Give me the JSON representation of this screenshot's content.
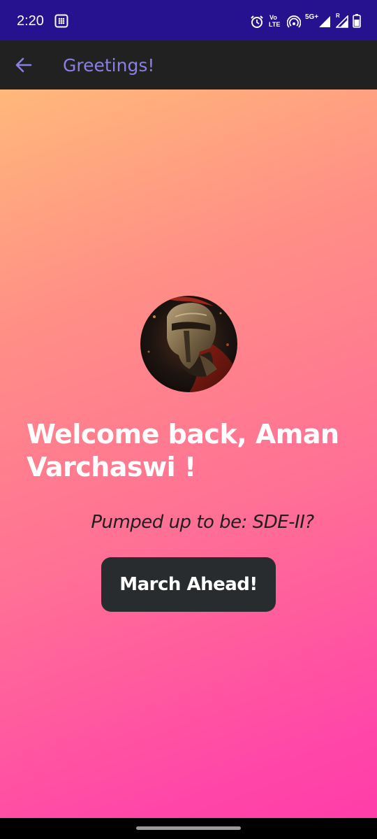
{
  "status_bar": {
    "time": "2:20",
    "volte_top": "Vo",
    "volte_bottom": "LTE",
    "network": "5G+",
    "roaming": "R",
    "background_color": "#26128f",
    "icons": [
      "notification-grid-icon",
      "alarm-icon",
      "volte-icon",
      "hotspot-icon",
      "signal-icon",
      "signal-roaming-icon",
      "battery-icon"
    ]
  },
  "app_bar": {
    "title": "Greetings!",
    "title_color": "#8a80e3",
    "background_color": "#212121",
    "back_icon": "arrow-left-icon"
  },
  "main": {
    "avatar_icon": "spartan-warrior-avatar",
    "welcome_text": "Welcome back, Aman Varchaswi !",
    "subtitle": "Pumped up to be: SDE-II?",
    "button_label": "March Ahead!",
    "button_color": "#282c2e",
    "gradient_colors": [
      "#ffb87a",
      "#ff8f86",
      "#ff6e96",
      "#ff48a7",
      "#ff3daa"
    ]
  },
  "nav_bar": {
    "handle": "home-gesture-handle"
  }
}
